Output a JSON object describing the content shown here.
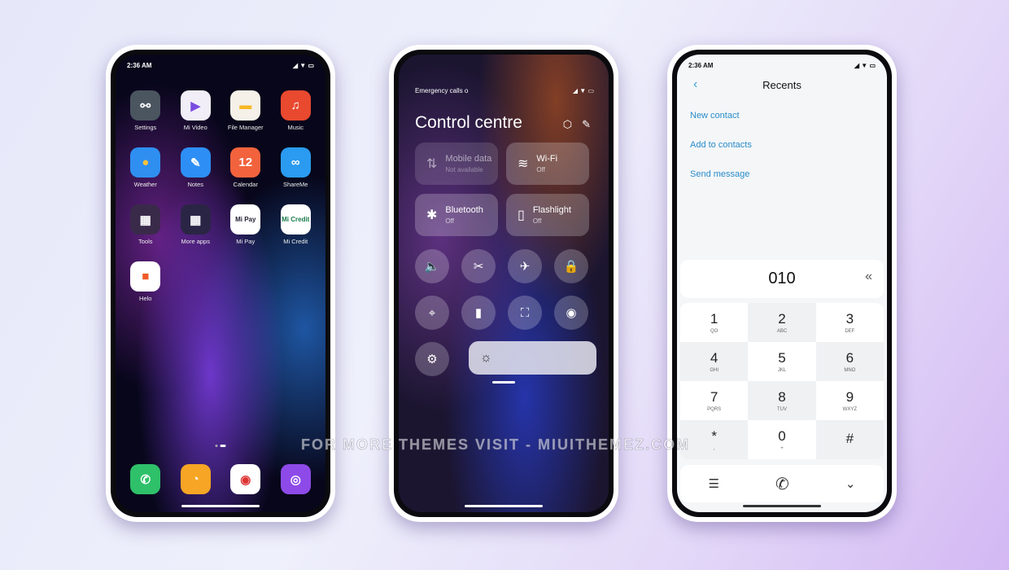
{
  "home": {
    "time": "2:36 AM",
    "apps": [
      {
        "label": "Settings",
        "glyph": "⚯",
        "color": "#4a5560"
      },
      {
        "label": "Mi Video",
        "glyph": "▶",
        "color": "#f1eef8",
        "fg": "#7a4be0"
      },
      {
        "label": "File Manager",
        "glyph": "▬",
        "color": "#f5f1e8",
        "fg": "#f7b823"
      },
      {
        "label": "Music",
        "glyph": "♫",
        "color": "#e8492f"
      },
      {
        "label": "Weather",
        "glyph": "●",
        "color": "#2f8ff0",
        "fg": "#f8c23a"
      },
      {
        "label": "Notes",
        "glyph": "✎",
        "color": "#2d8ff5"
      },
      {
        "label": "Calendar",
        "glyph": "12",
        "color": "#f2633d"
      },
      {
        "label": "ShareMe",
        "glyph": "∞",
        "color": "#2a9bf0"
      },
      {
        "label": "Tools",
        "glyph": "▦",
        "color": "#3a2a4a"
      },
      {
        "label": "More apps",
        "glyph": "▦",
        "color": "#2a2545"
      },
      {
        "label": "Mi Pay",
        "glyph": "Mi Pay",
        "color": "#fff",
        "fg": "#223"
      },
      {
        "label": "Mi Credit",
        "glyph": "Mi Credit",
        "color": "#fff",
        "fg": "#1a7a4a"
      },
      {
        "label": "Helo",
        "glyph": "■",
        "color": "#fff",
        "fg": "#f05a28"
      }
    ],
    "dock": [
      {
        "name": "phone",
        "glyph": "✆",
        "color": "#2fc06a"
      },
      {
        "name": "messaging",
        "glyph": "◔",
        "color": "#f6a524"
      },
      {
        "name": "chrome",
        "glyph": "◉",
        "color": "#fff",
        "fg": "#d33"
      },
      {
        "name": "camera",
        "glyph": "◎",
        "color": "#8d4ae8"
      }
    ]
  },
  "control": {
    "status": "Emergency calls o",
    "title": "Control centre",
    "tiles": [
      {
        "label": "Mobile data",
        "state": "Not available",
        "icon": "⇅"
      },
      {
        "label": "Wi-Fi",
        "state": "Off",
        "icon": "≋"
      },
      {
        "label": "Bluetooth",
        "state": "Off",
        "icon": "✱"
      },
      {
        "label": "Flashlight",
        "state": "Off",
        "icon": "▯"
      }
    ],
    "toggles": [
      "🔈",
      "✂",
      "✈",
      "🔒",
      "⌖",
      "▮",
      "⛶",
      "◉",
      "⚙"
    ],
    "brightness_icon": "☼",
    "brightness_level": 0.14
  },
  "dialer": {
    "time": "2:36 AM",
    "title": "Recents",
    "links": [
      "New contact",
      "Add to contacts",
      "Send message"
    ],
    "number": "010",
    "keys": [
      {
        "d": "1",
        "l": "QO"
      },
      {
        "d": "2",
        "l": "ABC"
      },
      {
        "d": "3",
        "l": "DEF"
      },
      {
        "d": "4",
        "l": "GHI"
      },
      {
        "d": "5",
        "l": "JKL"
      },
      {
        "d": "6",
        "l": "MNO"
      },
      {
        "d": "7",
        "l": "PQRS"
      },
      {
        "d": "8",
        "l": "TUV"
      },
      {
        "d": "9",
        "l": "WXYZ"
      },
      {
        "d": "*",
        "l": ","
      },
      {
        "d": "0",
        "l": "+"
      },
      {
        "d": "#",
        "l": ""
      }
    ]
  },
  "watermark": "FOR MORE THEMES VISIT - MIUITHEMEZ.COM"
}
